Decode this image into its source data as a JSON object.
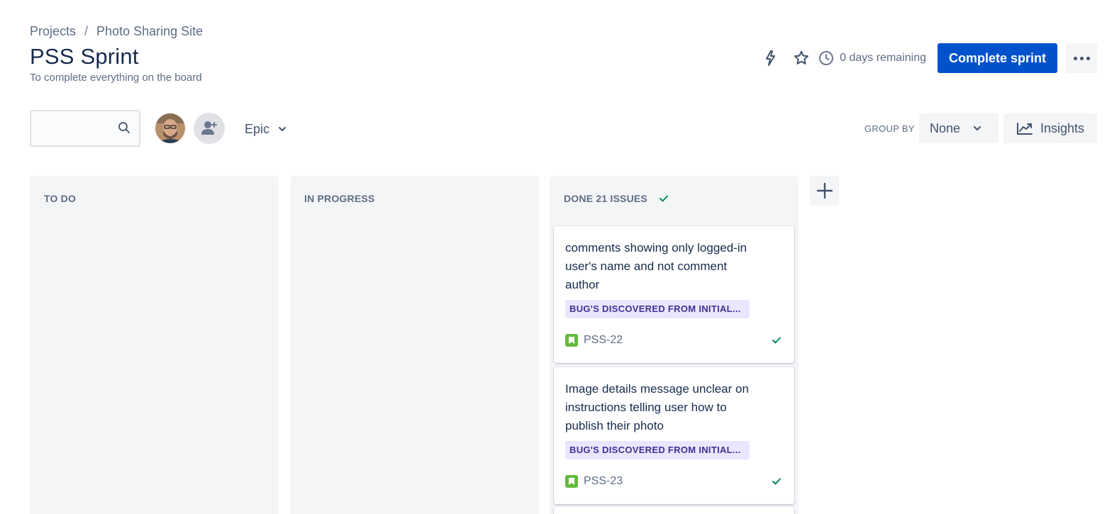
{
  "breadcrumb": {
    "root": "Projects",
    "separator": "/",
    "project": "Photo Sharing Site"
  },
  "sprint": {
    "title": "PSS Sprint",
    "goal": "To complete everything on the board"
  },
  "header_actions": {
    "automation_icon": "lightning-icon",
    "star_icon": "star-icon",
    "clock_icon": "clock-icon",
    "time_remaining": "0 days remaining",
    "complete_label": "Complete sprint",
    "more_icon": "more-horizontal-icon"
  },
  "toolbar": {
    "search": {
      "value": "",
      "placeholder": ""
    },
    "epic_label": "Epic",
    "group_by_label": "GROUP BY",
    "group_by_value": "None",
    "insights_label": "Insights"
  },
  "board": {
    "columns": [
      {
        "title": "TO DO",
        "count": ""
      },
      {
        "title": "IN PROGRESS",
        "count": ""
      },
      {
        "title": "DONE",
        "count": "21 ISSUES"
      }
    ],
    "done_cards": [
      {
        "summary": "comments showing only logged-in user's name and not comment author",
        "epic": "BUG'S DISCOVERED FROM INITIAL...",
        "key": "PSS-22",
        "type": "story"
      },
      {
        "summary": "Image details message unclear on instructions telling user how to publish their photo",
        "epic": "BUG'S DISCOVERED FROM INITIAL...",
        "key": "PSS-23",
        "type": "story"
      }
    ]
  },
  "colors": {
    "primary": "#0052cc",
    "epic_bg": "#eae6ff",
    "epic_text": "#403294",
    "story_green": "#63ba3c",
    "done_check": "#00875a",
    "column_bg": "#f4f5f7"
  }
}
